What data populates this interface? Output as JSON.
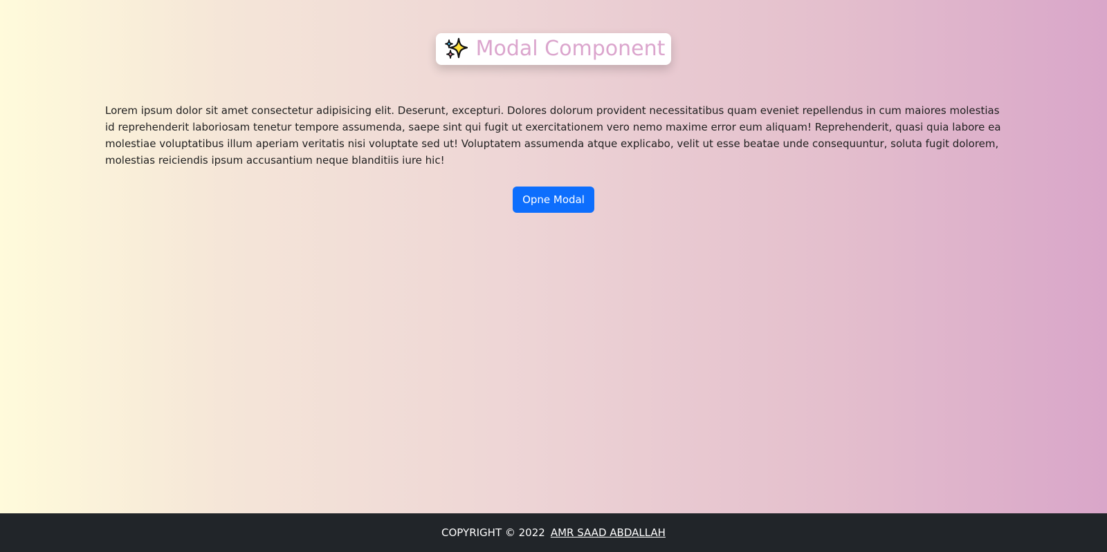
{
  "header": {
    "title": "Modal Component",
    "icon": "sparkles-icon"
  },
  "main": {
    "paragraph": "Lorem ipsum dolor sit amet consectetur adipisicing elit. Deserunt, excepturi. Dolores dolorum provident necessitatibus quam eveniet repellendus in cum maiores molestias id reprehenderit laboriosam tenetur tempore assumenda, saepe sint qui fugit ut exercitationem vero nemo maxime error eum aliquam! Reprehenderit, quasi quia labore ea molestiae voluptatibus illum aperiam veritatis nisi voluptate sed ut! Voluptatem assumenda atque explicabo, velit ut esse beatae unde consequuntur, soluta fugit dolorem, molestias reiciendis ipsum accusantium neque blanditiis iure hic!",
    "open_button_label": "Opne Modal"
  },
  "footer": {
    "copyright": "COPYRIGHT © 2022",
    "author": "AMR SAAD ABDALLAH"
  },
  "colors": {
    "title": "#dba5cd",
    "button": "#0d6efd",
    "footer_bg": "#212529",
    "gradient_start": "#fffbdb",
    "gradient_end": "#d9a6c9"
  }
}
